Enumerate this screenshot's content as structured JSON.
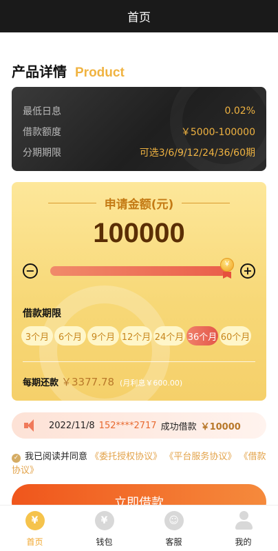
{
  "header": {
    "title": "首页"
  },
  "product": {
    "title_cn": "产品详情",
    "title_en": "Product",
    "rows": [
      {
        "label": "最低日息",
        "value": "0.02%"
      },
      {
        "label": "借款额度",
        "value": "￥5000-100000"
      },
      {
        "label": "分期期限",
        "value": "可选3/6/9/12/24/36/60期"
      }
    ]
  },
  "apply": {
    "title": "申请金额(元)",
    "amount": "100000",
    "slider_value_fraction": 1.0,
    "minus_symbol": "−",
    "plus_symbol": "+",
    "thumb_symbol": "￥",
    "term_label": "借款期限",
    "terms": [
      "3个月",
      "6个月",
      "9个月",
      "12个月",
      "24个月",
      "36个月",
      "60个月"
    ],
    "selected_term": "36个月",
    "repay_label": "每期还款",
    "repay_value": "￥3377.78",
    "repay_note": "(月利息￥600.00)"
  },
  "notice": {
    "date": "2022/11/8",
    "phone": "152****2717",
    "text": "成功借款",
    "amount": "￥10000"
  },
  "agreement": {
    "prefix": "我已阅读并同意",
    "links": [
      "《委托授权协议》",
      "《平台服务协议》",
      "《借款协议》"
    ]
  },
  "cta": {
    "label": "立即借款"
  },
  "tabbar": [
    {
      "label": "首页",
      "icon": "home-icon",
      "active": true
    },
    {
      "label": "钱包",
      "icon": "wallet-icon",
      "active": false
    },
    {
      "label": "客服",
      "icon": "service-icon",
      "active": false
    },
    {
      "label": "我的",
      "icon": "user-icon",
      "active": false
    }
  ],
  "colors": {
    "accent": "#f0b341",
    "cta": "#f0561c",
    "active_tab": "#f0a52a"
  }
}
